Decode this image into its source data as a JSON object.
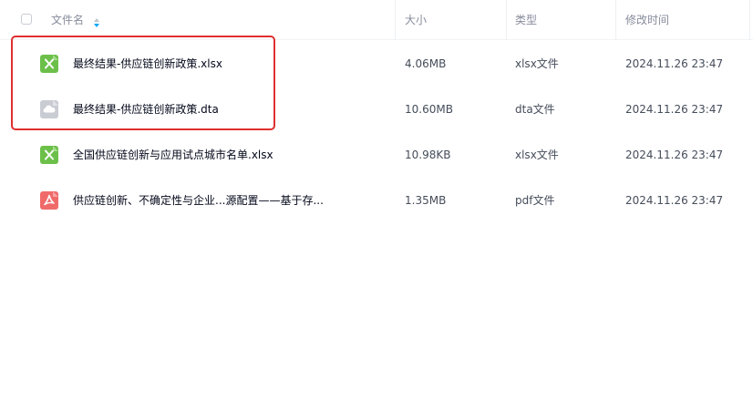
{
  "header": {
    "name_label": "文件名",
    "size_label": "大小",
    "type_label": "类型",
    "modified_label": "修改时间"
  },
  "files": [
    {
      "name": "最终结果-供应链创新政策.xlsx",
      "size": "4.06MB",
      "type": "xlsx文件",
      "modified": "2024.11.26 23:47",
      "icon": "excel-icon"
    },
    {
      "name": "最终结果-供应链创新政策.dta",
      "size": "10.60MB",
      "type": "dta文件",
      "modified": "2024.11.26 23:47",
      "icon": "cloud-file-icon"
    },
    {
      "name": "全国供应链创新与应用试点城市名单.xlsx",
      "size": "10.98KB",
      "type": "xlsx文件",
      "modified": "2024.11.26 23:47",
      "icon": "excel-icon"
    },
    {
      "name": "供应链创新、不确定性与企业...源配置——基于存...",
      "size": "1.35MB",
      "type": "pdf文件",
      "modified": "2024.11.26 23:47",
      "icon": "pdf-icon"
    }
  ],
  "colors": {
    "excel": "#6cc04a",
    "cloud": "#c9ccd3",
    "pdf": "#f06a6a",
    "highlight": "#e02f2f",
    "sort_active": "#06a7ff"
  }
}
